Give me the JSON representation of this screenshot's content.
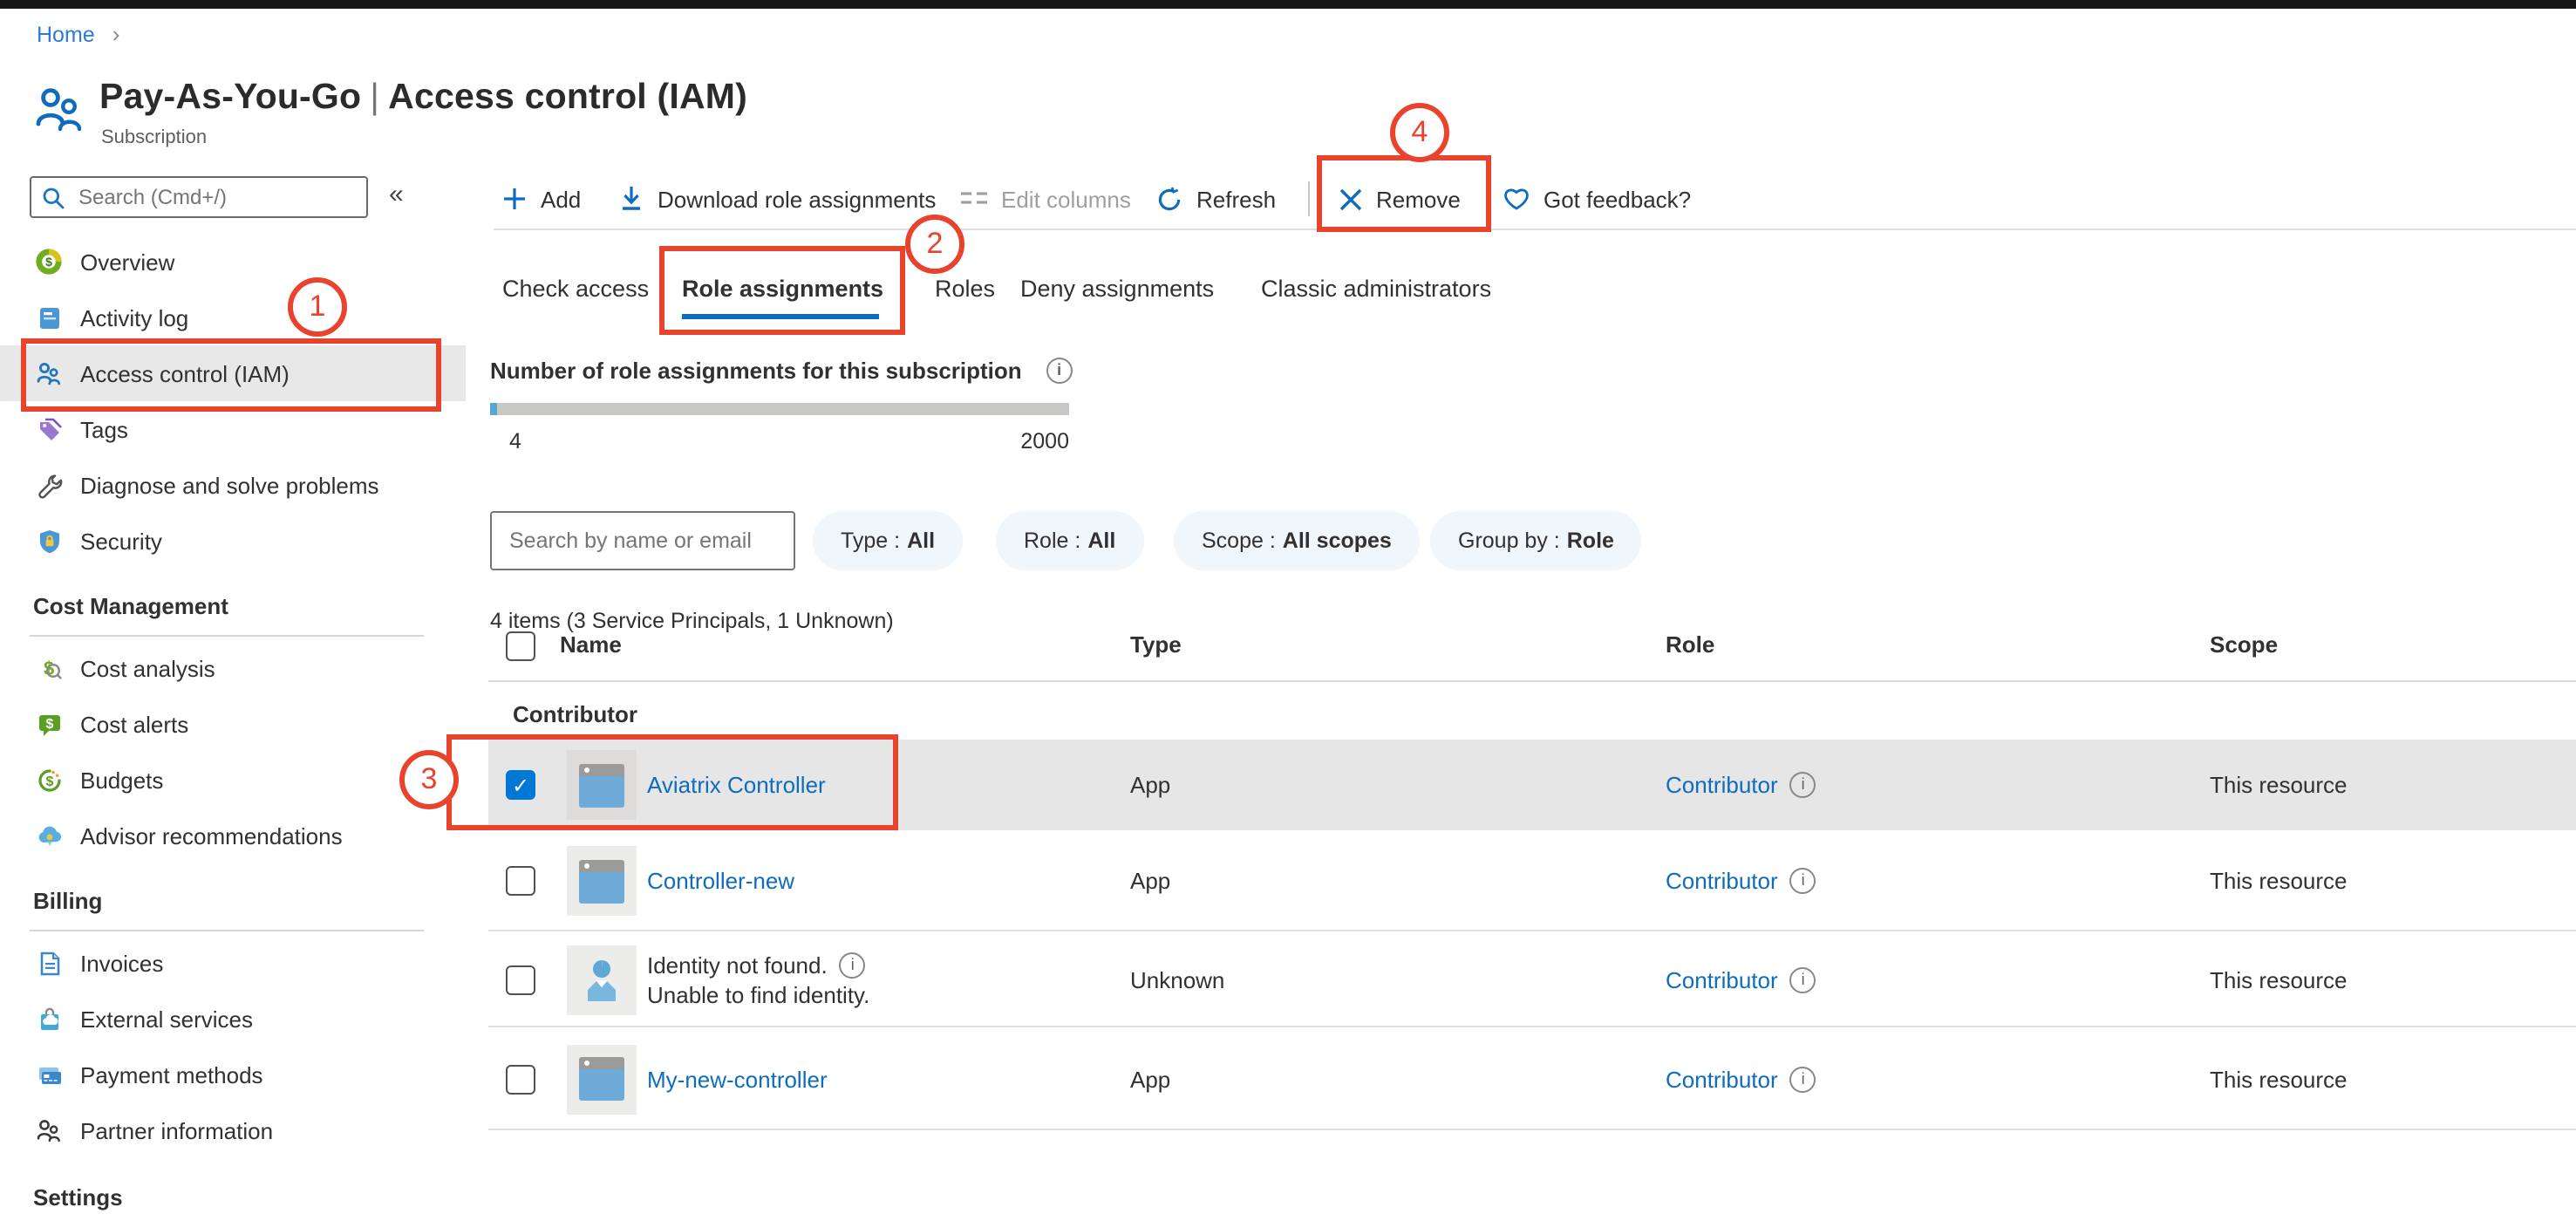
{
  "breadcrumb": {
    "home": "Home"
  },
  "header": {
    "title_resource": "Pay-As-You-Go",
    "title_section": "Access control (IAM)",
    "subtitle": "Subscription"
  },
  "icons": {
    "info": "i",
    "check": "✓",
    "breadcrumb_chevron": "›",
    "collapse": "«",
    "pipe": "|"
  },
  "sidebar": {
    "search_placeholder": "Search (Cmd+/)",
    "items_top": [
      {
        "label": "Overview"
      },
      {
        "label": "Activity log"
      },
      {
        "label": "Access control (IAM)"
      },
      {
        "label": "Tags"
      },
      {
        "label": "Diagnose and solve problems"
      },
      {
        "label": "Security"
      }
    ],
    "sections": [
      {
        "heading": "Cost Management",
        "items": [
          "Cost analysis",
          "Cost alerts",
          "Budgets",
          "Advisor recommendations"
        ]
      },
      {
        "heading": "Billing",
        "items": [
          "Invoices",
          "External services",
          "Payment methods",
          "Partner information"
        ]
      },
      {
        "heading": "Settings",
        "items": []
      }
    ]
  },
  "toolbar": {
    "add": "Add",
    "download": "Download role assignments",
    "edit_columns": "Edit columns",
    "refresh": "Refresh",
    "remove": "Remove",
    "feedback": "Got feedback?"
  },
  "tabs": [
    {
      "label": "Check access"
    },
    {
      "label": "Role assignments"
    },
    {
      "label": "Roles"
    },
    {
      "label": "Deny assignments"
    },
    {
      "label": "Classic administrators"
    }
  ],
  "meter": {
    "title": "Number of role assignments for this subscription",
    "current": "4",
    "max": "2000"
  },
  "filters": {
    "search_placeholder": "Search by name or email",
    "pills": [
      {
        "label": "Type :",
        "value": "All"
      },
      {
        "label": "Role :",
        "value": "All"
      },
      {
        "label": "Scope :",
        "value": "All scopes"
      },
      {
        "label": "Group by :",
        "value": "Role"
      }
    ]
  },
  "table": {
    "items_summary": "4 items (3 Service Principals, 1 Unknown)",
    "columns": {
      "name": "Name",
      "type": "Type",
      "role": "Role",
      "scope": "Scope"
    },
    "group": "Contributor",
    "rows": [
      {
        "name": "Aviatrix Controller",
        "type": "App",
        "role": "Contributor",
        "scope": "This resource"
      },
      {
        "name": "Controller-new",
        "type": "App",
        "role": "Contributor",
        "scope": "This resource"
      },
      {
        "name": "Identity not found.",
        "subtext": "Unable to find identity.",
        "type": "Unknown",
        "role": "Contributor",
        "scope": "This resource"
      },
      {
        "name": "My-new-controller",
        "type": "App",
        "role": "Contributor",
        "scope": "This resource"
      }
    ]
  },
  "annotations": {
    "step1": "1",
    "step2": "2",
    "step3": "3",
    "step4": "4",
    "color": "#e8432c"
  }
}
